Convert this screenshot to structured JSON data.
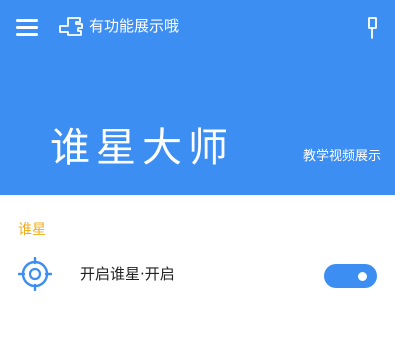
{
  "header": {
    "hint_text": "有功能展示哦",
    "app_title": "谁星大师",
    "tutorial_link": "教学视频展示",
    "background_color": "#3d8ef2",
    "menu_icon": "menu-icon",
    "hint_icon": "pointing-hand-icon",
    "more_icon": "more-vertical-icon"
  },
  "section": {
    "label": "谁星",
    "label_color": "#f0ad1c",
    "items": [
      {
        "label": "开启谁星·开启",
        "icon": "locate-target-icon",
        "toggle_on": true
      }
    ]
  }
}
